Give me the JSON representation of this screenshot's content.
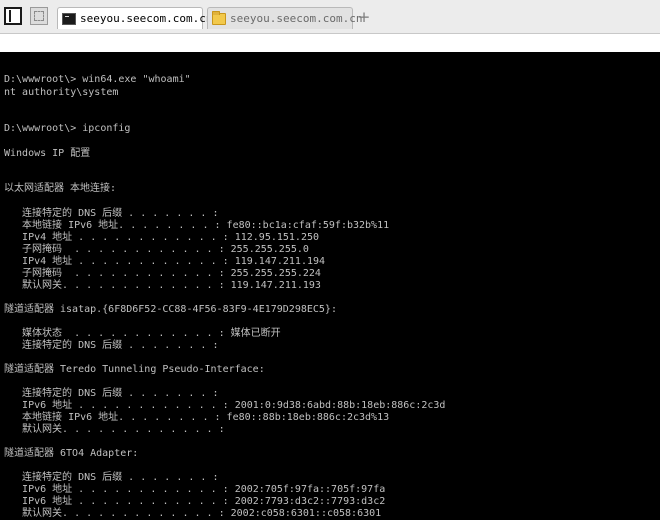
{
  "browser": {
    "tabs": [
      {
        "title": "seeyou.seecom.com.cn",
        "icon": "terminal-icon",
        "active": true
      },
      {
        "title": "seeyou.seecom.com.cn",
        "icon": "folder-icon",
        "active": false
      }
    ],
    "new_tab_label": "+"
  },
  "terminal": {
    "lines": [
      "D:\\wwwroot\\> win64.exe \"whoami\"",
      "nt authority\\system",
      "D:\\wwwroot\\> ipconfig",
      "Windows IP 配置",
      "以太网适配器 本地连接:",
      "   连接特定的 DNS 后缀 . . . . . . . :",
      "   本地链接 IPv6 地址. . . . . . . . : fe80::bc1a:cfaf:59f:b32b%11",
      "   IPv4 地址 . . . . . . . . . . . . : 112.95.151.250",
      "   子网掩码  . . . . . . . . . . . . : 255.255.255.0",
      "   IPv4 地址 . . . . . . . . . . . . : 119.147.211.194",
      "   子网掩码  . . . . . . . . . . . . : 255.255.255.224",
      "   默认网关. . . . . . . . . . . . . : 119.147.211.193",
      "隧道适配器 isatap.{6F8D6F52-CC88-4F56-83F9-4E179D298EC5}:",
      "   媒体状态  . . . . . . . . . . . . : 媒体已断开",
      "   连接特定的 DNS 后缀 . . . . . . . :",
      "隧道适配器 Teredo Tunneling Pseudo-Interface:",
      "   连接特定的 DNS 后缀 . . . . . . . :",
      "   IPv6 地址 . . . . . . . . . . . . : 2001:0:9d38:6abd:88b:18eb:886c:2c3d",
      "   本地链接 IPv6 地址. . . . . . . . : fe80::88b:18eb:886c:2c3d%13",
      "   默认网关. . . . . . . . . . . . . :",
      "隧道适配器 6TO4 Adapter:",
      "   连接特定的 DNS 后缀 . . . . . . . :",
      "   IPv6 地址 . . . . . . . . . . . . : 2002:705f:97fa::705f:97fa",
      "   IPv6 地址 . . . . . . . . . . . . : 2002:7793:d3c2::7793:d3c2",
      "   默认网关. . . . . . . . . . . . . : 2002:c058:6301::c058:6301"
    ]
  }
}
